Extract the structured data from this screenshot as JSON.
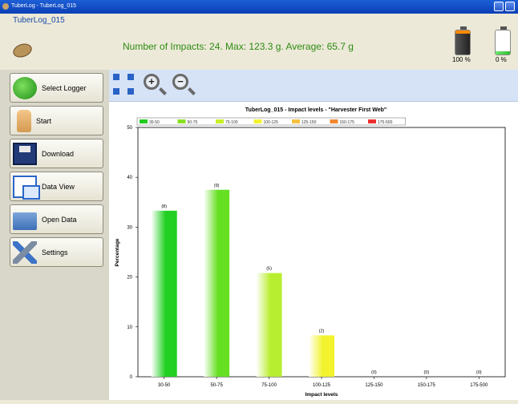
{
  "window": {
    "title": "TuberLog - TuberLog_015"
  },
  "header": {
    "doc_title": "TuberLog_015",
    "summary": "Number of Impacts: 24. Max: 123.3 g. Average: 65.7 g",
    "battery1_pct": "100 %",
    "battery2_pct": "0 %",
    "battery1_level": 1.0,
    "battery2_level": 0.0
  },
  "nav": {
    "items": [
      {
        "label": "Select Logger",
        "icon": "refresh-icon"
      },
      {
        "label": "Start",
        "icon": "thumbs-up-icon"
      },
      {
        "label": "Download",
        "icon": "floppy-icon"
      },
      {
        "label": "Data View",
        "icon": "windows-icon"
      },
      {
        "label": "Open Data",
        "icon": "folder-icon"
      },
      {
        "label": "Settings",
        "icon": "tools-icon"
      }
    ]
  },
  "toolbar": {
    "items": [
      {
        "icon": "fit-to-window-icon"
      },
      {
        "icon": "zoom-in-icon"
      },
      {
        "icon": "zoom-out-icon"
      }
    ]
  },
  "chart_data": {
    "type": "bar",
    "title": "TuberLog_015 - Impact levels - \"Harvester First Web\"",
    "xlabel": "Impact levels",
    "ylabel": "Percentage",
    "ylim": [
      0,
      50
    ],
    "yticks": [
      0,
      10,
      20,
      30,
      40,
      50
    ],
    "categories": [
      "30-50",
      "50-75",
      "75-100",
      "100-125",
      "125-150",
      "150-175",
      "175-500"
    ],
    "values": [
      33.3,
      37.5,
      20.8,
      8.3,
      0,
      0,
      0
    ],
    "counts": [
      "(8)",
      "(9)",
      "(5)",
      "(2)",
      "(0)",
      "(0)",
      "(0)"
    ],
    "legend": [
      "30-50",
      "50-75",
      "75-100",
      "100-125",
      "125-150",
      "150-175",
      "175-500"
    ],
    "legend_colors": [
      "#22cc22",
      "#88e022",
      "#c8f028",
      "#f4f430",
      "#f6c040",
      "#f08830",
      "#ee3030"
    ],
    "bar_colors": [
      "#22d022",
      "#66e022",
      "#b8ee30",
      "#f2f22e",
      "#f6c040",
      "#f08830",
      "#ee3030"
    ],
    "legend_placement": "top",
    "grid": false
  }
}
